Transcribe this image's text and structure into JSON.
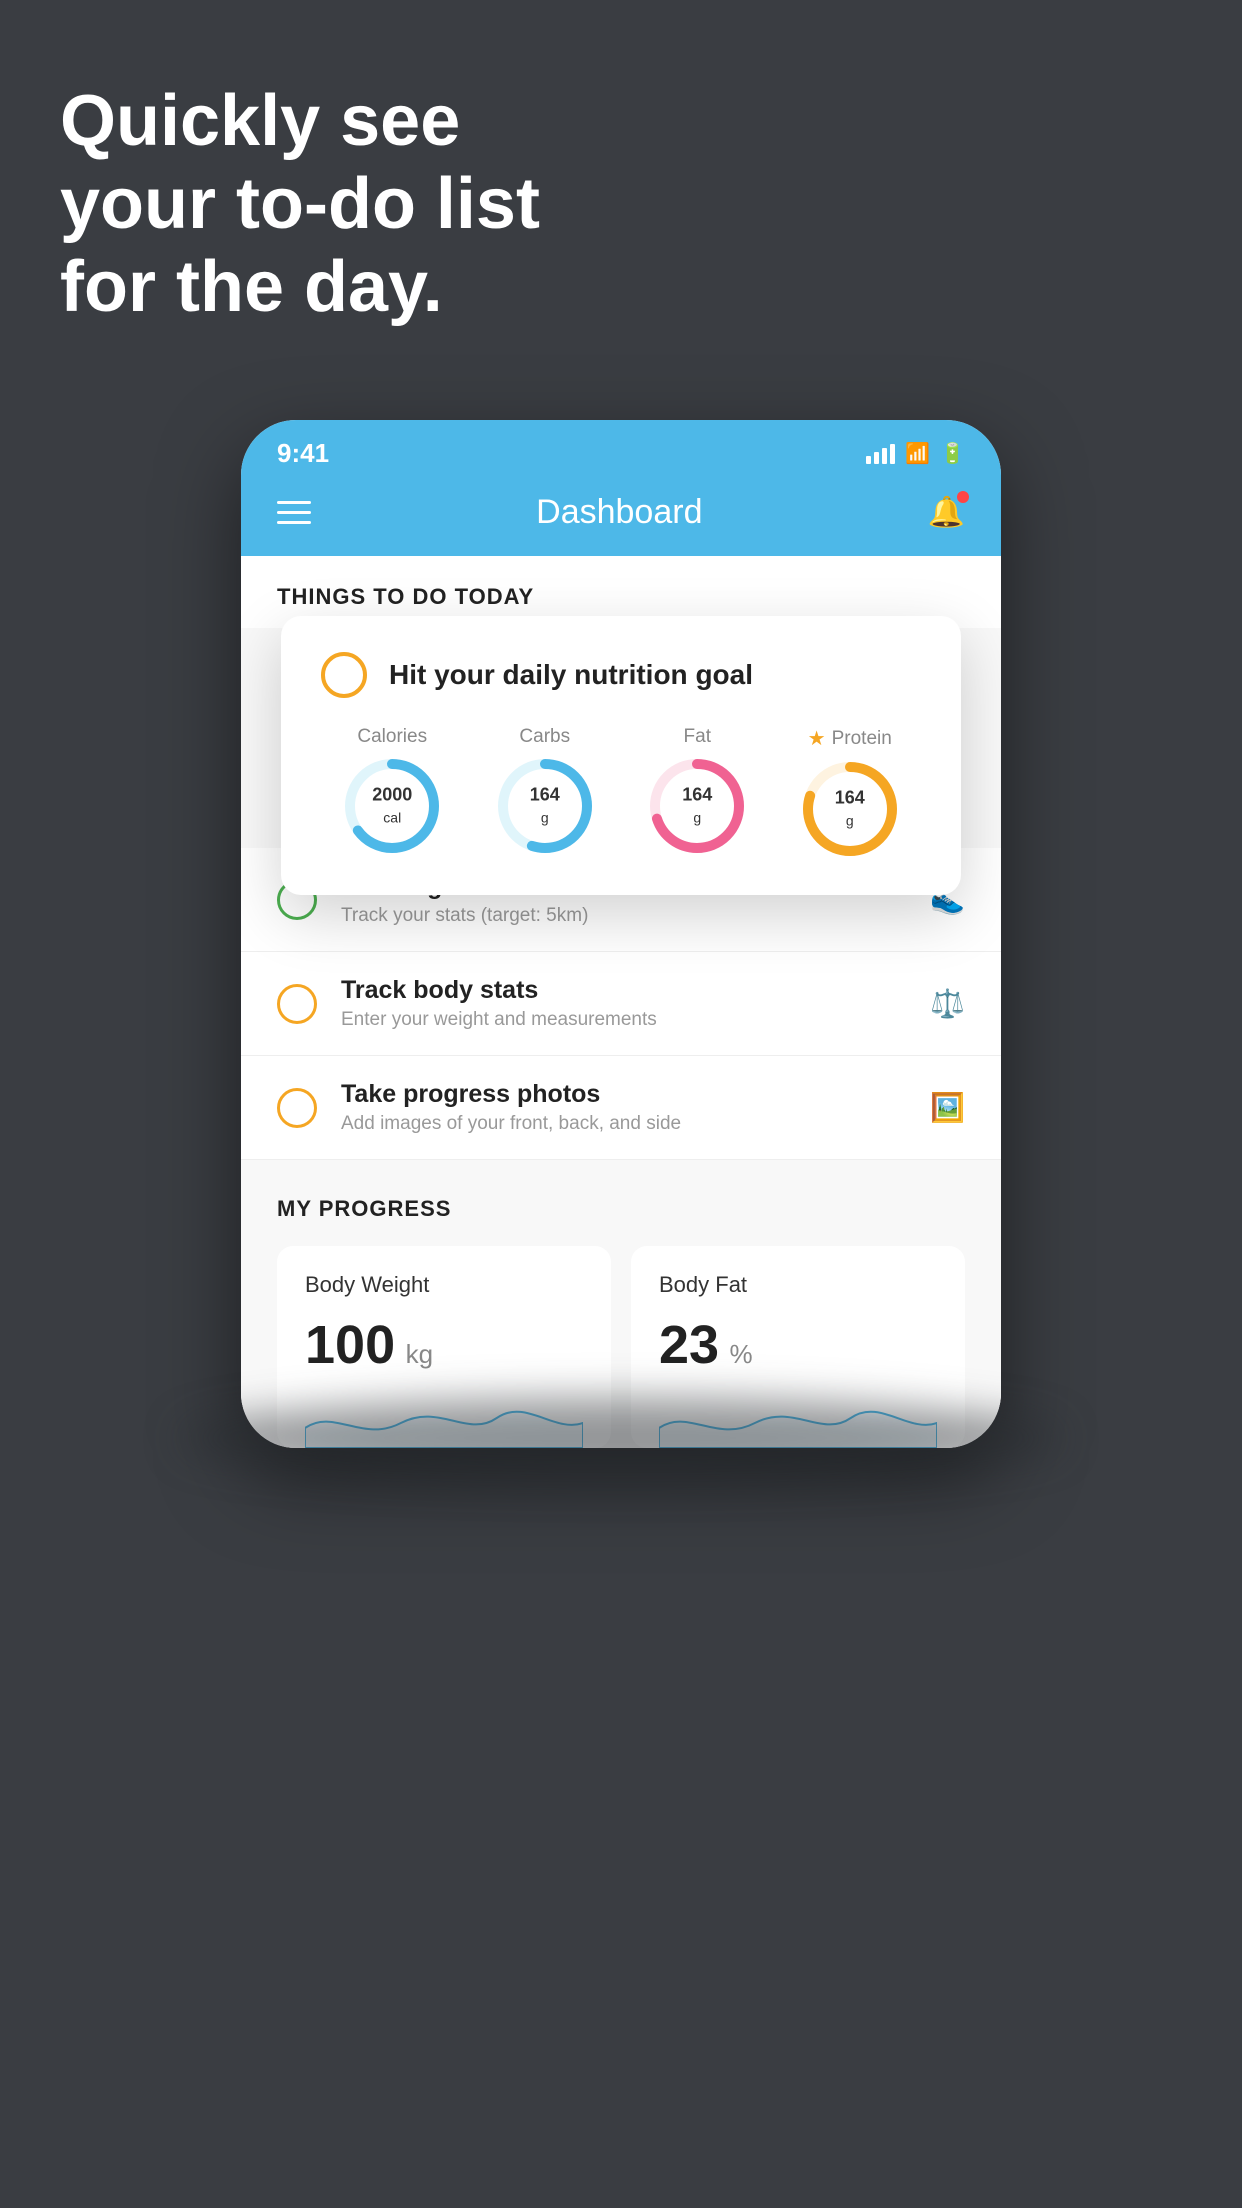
{
  "hero": {
    "line1": "Quickly see",
    "line2": "your to-do list",
    "line3": "for the day."
  },
  "statusBar": {
    "time": "9:41"
  },
  "header": {
    "title": "Dashboard"
  },
  "sectionTitle": "THINGS TO DO TODAY",
  "popupCard": {
    "title": "Hit your daily nutrition goal",
    "items": [
      {
        "label": "Calories",
        "value": "2000",
        "unit": "cal",
        "color": "#4db8e8",
        "trackColor": "#e0f5fb",
        "percent": 65
      },
      {
        "label": "Carbs",
        "value": "164",
        "unit": "g",
        "color": "#4db8e8",
        "trackColor": "#e0f5fb",
        "percent": 55
      },
      {
        "label": "Fat",
        "value": "164",
        "unit": "g",
        "color": "#f06292",
        "trackColor": "#fce4ec",
        "percent": 70
      },
      {
        "label": "Protein",
        "value": "164",
        "unit": "g",
        "color": "#f5a623",
        "trackColor": "#fef3e0",
        "percent": 80,
        "starred": true
      }
    ]
  },
  "todoItems": [
    {
      "title": "Running",
      "subtitle": "Track your stats (target: 5km)",
      "circleColor": "green",
      "icon": "shoe"
    },
    {
      "title": "Track body stats",
      "subtitle": "Enter your weight and measurements",
      "circleColor": "yellow",
      "icon": "scale"
    },
    {
      "title": "Take progress photos",
      "subtitle": "Add images of your front, back, and side",
      "circleColor": "yellow-2",
      "icon": "portrait"
    }
  ],
  "progressSection": {
    "title": "MY PROGRESS",
    "cards": [
      {
        "title": "Body Weight",
        "value": "100",
        "unit": "kg"
      },
      {
        "title": "Body Fat",
        "value": "23",
        "unit": "%"
      }
    ]
  }
}
